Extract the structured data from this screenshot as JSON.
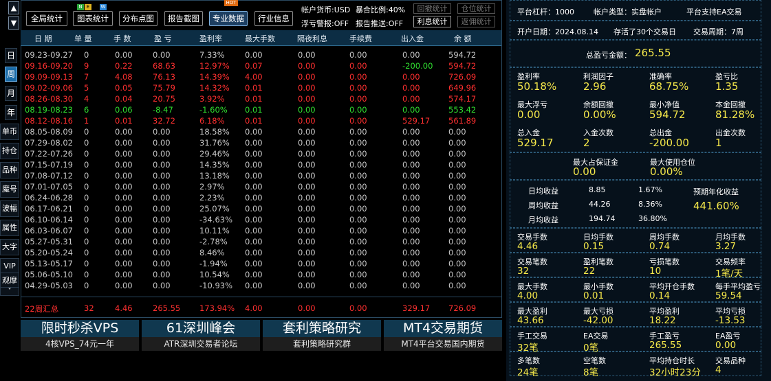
{
  "nav": {
    "up_arrow": "▲",
    "down_arrow": "▼"
  },
  "period_tabs": [
    "日",
    "周",
    "月",
    "年"
  ],
  "side_tabs": [
    "单币",
    "持仓",
    "品种",
    "魔号",
    "波幅",
    "属性",
    "大字",
    "VIP",
    "观摩",
    "˅"
  ],
  "toolbar": {
    "buttons": [
      "全局统计",
      "图表统计",
      "分布点图",
      "报告截图",
      "专业数据",
      "行业信息"
    ],
    "new_badge": [
      "N",
      "E",
      "W"
    ],
    "hot_badge": "HOT",
    "account_currency": "帐户货币:USD",
    "exposure": "暴合比例:40%",
    "float_alert": "浮亏警报:OFF",
    "report_push": "报告推送:OFF",
    "right_buttons": [
      "回撤统计",
      "仓位统计",
      "利息统计",
      "返佣统计"
    ]
  },
  "table": {
    "headers": [
      "日 期",
      "单 量",
      "手 数",
      "盈 亏",
      "盈利率",
      "最大手数",
      "隔夜利息",
      "手续费",
      "出入金",
      "余 额"
    ],
    "rows": [
      {
        "c": [
          "09.23-09.27",
          "0",
          "0.00",
          "0.00",
          "7.33%",
          "0.00",
          "0.00",
          "0.00",
          "0.00",
          "594.72"
        ],
        "color": "gray"
      },
      {
        "c": [
          "09.16-09.20",
          "9",
          "0.22",
          "68.63",
          "12.97%",
          "0.07",
          "0.00",
          "0.00",
          "-200.00",
          "594.72"
        ],
        "color": "red"
      },
      {
        "c": [
          "09.09-09.13",
          "7",
          "4.08",
          "76.13",
          "14.39%",
          "4.00",
          "0.00",
          "0.00",
          "0.00",
          "726.09"
        ],
        "color": "red"
      },
      {
        "c": [
          "09.02-09.06",
          "5",
          "0.05",
          "75.79",
          "14.32%",
          "0.01",
          "0.00",
          "0.00",
          "0.00",
          "649.96"
        ],
        "color": "red"
      },
      {
        "c": [
          "08.26-08.30",
          "4",
          "0.04",
          "20.75",
          "3.92%",
          "0.01",
          "0.00",
          "0.00",
          "0.00",
          "574.17"
        ],
        "color": "red"
      },
      {
        "c": [
          "08.19-08.23",
          "6",
          "0.06",
          "-8.47",
          "-1.60%",
          "0.01",
          "0.00",
          "0.00",
          "0.00",
          "553.42"
        ],
        "color": "green"
      },
      {
        "c": [
          "08.12-08.16",
          "1",
          "0.01",
          "32.72",
          "6.18%",
          "0.01",
          "0.00",
          "0.00",
          "529.17",
          "561.89"
        ],
        "color": "red"
      },
      {
        "c": [
          "08.05-08.09",
          "0",
          "0.00",
          "0.00",
          "18.58%",
          "0.00",
          "0.00",
          "0.00",
          "0.00",
          "0.00"
        ],
        "color": "gray"
      },
      {
        "c": [
          "07.29-08.02",
          "0",
          "0.00",
          "0.00",
          "31.76%",
          "0.00",
          "0.00",
          "0.00",
          "0.00",
          "0.00"
        ],
        "color": "gray"
      },
      {
        "c": [
          "07.22-07.26",
          "0",
          "0.00",
          "0.00",
          "29.46%",
          "0.00",
          "0.00",
          "0.00",
          "0.00",
          "0.00"
        ],
        "color": "gray"
      },
      {
        "c": [
          "07.15-07.19",
          "0",
          "0.00",
          "0.00",
          "14.35%",
          "0.00",
          "0.00",
          "0.00",
          "0.00",
          "0.00"
        ],
        "color": "gray"
      },
      {
        "c": [
          "07.08-07.12",
          "0",
          "0.00",
          "0.00",
          "13.18%",
          "0.00",
          "0.00",
          "0.00",
          "0.00",
          "0.00"
        ],
        "color": "gray"
      },
      {
        "c": [
          "07.01-07.05",
          "0",
          "0.00",
          "0.00",
          "2.97%",
          "0.00",
          "0.00",
          "0.00",
          "0.00",
          "0.00"
        ],
        "color": "gray"
      },
      {
        "c": [
          "06.24-06.28",
          "0",
          "0.00",
          "0.00",
          "2.23%",
          "0.00",
          "0.00",
          "0.00",
          "0.00",
          "0.00"
        ],
        "color": "gray"
      },
      {
        "c": [
          "06.17-06.21",
          "0",
          "0.00",
          "0.00",
          "25.07%",
          "0.00",
          "0.00",
          "0.00",
          "0.00",
          "0.00"
        ],
        "color": "gray"
      },
      {
        "c": [
          "06.10-06.14",
          "0",
          "0.00",
          "0.00",
          "-34.63%",
          "0.00",
          "0.00",
          "0.00",
          "0.00",
          "0.00"
        ],
        "color": "gray"
      },
      {
        "c": [
          "06.03-06.07",
          "0",
          "0.00",
          "0.00",
          "10.11%",
          "0.00",
          "0.00",
          "0.00",
          "0.00",
          "0.00"
        ],
        "color": "gray"
      },
      {
        "c": [
          "05.27-05.31",
          "0",
          "0.00",
          "0.00",
          "-2.78%",
          "0.00",
          "0.00",
          "0.00",
          "0.00",
          "0.00"
        ],
        "color": "gray"
      },
      {
        "c": [
          "05.20-05.24",
          "0",
          "0.00",
          "0.00",
          "8.46%",
          "0.00",
          "0.00",
          "0.00",
          "0.00",
          "0.00"
        ],
        "color": "gray"
      },
      {
        "c": [
          "05.13-05.17",
          "0",
          "0.00",
          "0.00",
          "-1.94%",
          "0.00",
          "0.00",
          "0.00",
          "0.00",
          "0.00"
        ],
        "color": "gray"
      },
      {
        "c": [
          "05.06-05.10",
          "0",
          "0.00",
          "0.00",
          "10.54%",
          "0.00",
          "0.00",
          "0.00",
          "0.00",
          "0.00"
        ],
        "color": "gray"
      },
      {
        "c": [
          "04.29-05.03",
          "0",
          "0.00",
          "0.00",
          "-10.93%",
          "0.00",
          "0.00",
          "0.00",
          "0.00",
          "0.00"
        ],
        "color": "gray"
      }
    ],
    "io_green_row": 1,
    "summary": [
      "22周汇总",
      "32",
      "4.46",
      "265.55",
      "173.94%",
      "4.00",
      "0.00",
      "0.00",
      "329.17",
      "726.09"
    ]
  },
  "banners": [
    {
      "title": "限时秒杀VPS",
      "sub": "4核VPS_74元一年"
    },
    {
      "title": "61深圳峰会",
      "sub": "ATR深圳交易者论坛"
    },
    {
      "title": "套利策略研究",
      "sub": "套利策略研究群"
    },
    {
      "title": "MT4交易期货",
      "sub": "MT4平台交易国内期货"
    }
  ],
  "panel": {
    "leverage": "平台杠杆：1000",
    "account_type": "帐户类型：实盘帐户",
    "ea_support": "平台支持EA交易",
    "open_date": "开户日期：2024.08.14",
    "days_alive": "存活了30个交易日",
    "period": "交易周期：7周",
    "total_pl_label": "总盈亏金额：",
    "total_pl": "265.55",
    "grid1": [
      [
        "盈利率",
        "50.18%"
      ],
      [
        "利润因子",
        "2.96"
      ],
      [
        "准确率",
        "68.75%"
      ],
      [
        "盈亏比",
        "1.35"
      ],
      [
        "最大浮亏",
        "0.00"
      ],
      [
        "余额回撤",
        "0.00%"
      ],
      [
        "最小净值",
        "594.72"
      ],
      [
        "本金回撤",
        "81.28%"
      ],
      [
        "总入金",
        "529.17"
      ],
      [
        "入金次数",
        "2"
      ],
      [
        "总出金",
        "-200.00"
      ],
      [
        "出金次数",
        "1"
      ]
    ],
    "margin": [
      [
        "最大占保证金",
        "0.00"
      ],
      [
        "最大使用仓位",
        "0.00%"
      ]
    ],
    "avg": [
      [
        "日均收益",
        "8.85",
        "1.67%"
      ],
      [
        "周均收益",
        "44.26",
        "8.36%"
      ],
      [
        "月均收益",
        "194.74",
        "36.80%"
      ]
    ],
    "annual_label": "预期年化收益",
    "annual": "441.60%",
    "grid2": [
      [
        "交易手数",
        "4.46"
      ],
      [
        "日均手数",
        "0.15"
      ],
      [
        "周均手数",
        "0.74"
      ],
      [
        "月均手数",
        "3.27"
      ],
      [
        "交易笔数",
        "32"
      ],
      [
        "盈利笔数",
        "22"
      ],
      [
        "亏损笔数",
        "10"
      ],
      [
        "交易频率",
        "1笔/天"
      ],
      [
        "最大手数",
        "4.00"
      ],
      [
        "最小手数",
        "0.01"
      ],
      [
        "平均开仓手数",
        "0.14"
      ],
      [
        "每手平均盈亏",
        "59.54"
      ],
      [
        "最大盈利",
        "43.66"
      ],
      [
        "最大亏损",
        "-42.00"
      ],
      [
        "平均盈利",
        "18.22"
      ],
      [
        "平均亏损",
        "-13.53"
      ],
      [
        "手工交易",
        "32笔"
      ],
      [
        "EA交易",
        "0笔"
      ],
      [
        "手工盈亏",
        "265.55"
      ],
      [
        "EA盈亏",
        "0.00"
      ],
      [
        "多笔数",
        "24笔"
      ],
      [
        "空笔数",
        "8笔"
      ],
      [
        "平均持仓时长",
        "32小时23分"
      ],
      [
        "交易品种",
        "4"
      ]
    ]
  }
}
